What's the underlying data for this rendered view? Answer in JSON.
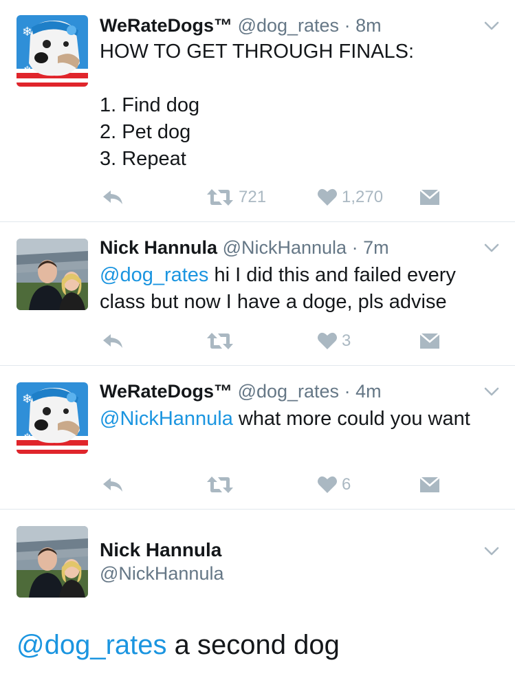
{
  "tweets": [
    {
      "name": "WeRateDogs™",
      "handle": "@dog_rates",
      "sep": "·",
      "time": "8m",
      "lines": [
        "HOW TO GET THROUGH FINALS:",
        "",
        "1. Find dog",
        "2. Pet dog",
        "3. Repeat"
      ],
      "retweets": "721",
      "likes": "1,270",
      "avatar_icon": "dog-avatar"
    },
    {
      "name": "Nick Hannula",
      "handle": "@NickHannula",
      "sep": "·",
      "time": "7m",
      "mention": "@dog_rates",
      "text": " hi I did this and failed every class but now I have a doge, pls advise",
      "retweets": "",
      "likes": "3",
      "avatar_icon": "couple-avatar"
    },
    {
      "name": "WeRateDogs™",
      "handle": "@dog_rates",
      "sep": "·",
      "time": "4m",
      "mention": "@NickHannula",
      "text": " what more could you want",
      "retweets": "",
      "likes": "6",
      "avatar_icon": "dog-avatar"
    }
  ],
  "focused": {
    "name": "Nick Hannula",
    "handle": "@NickHannula",
    "mention": "@dog_rates",
    "text": " a second dog",
    "avatar_icon": "couple-avatar"
  },
  "colors": {
    "link": "#1b95e0",
    "muted": "#657786",
    "icon": "#aab8c2",
    "divider": "#e1e8ed"
  }
}
